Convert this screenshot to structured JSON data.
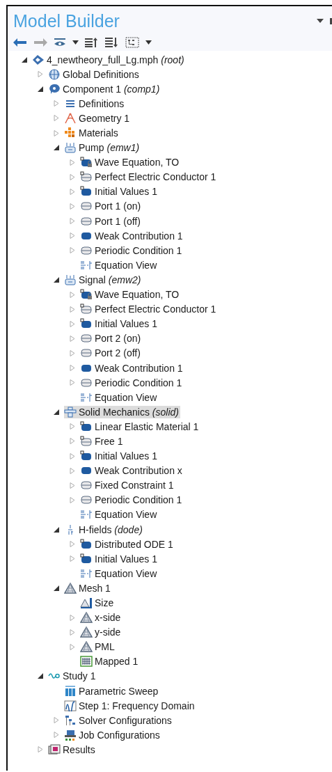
{
  "panel": {
    "title": "Model Builder"
  },
  "tree": [
    {
      "label": "4_newtheory_full_Lg.mph *(root)*",
      "kind": "file",
      "expanded": true,
      "selected": false,
      "children": [
        {
          "label": "Global Definitions",
          "kind": "globe",
          "expanded": false,
          "selected": false
        },
        {
          "label": "Component 1 *(comp1)*",
          "kind": "component",
          "expanded": true,
          "selected": false,
          "children": [
            {
              "label": "Definitions",
              "kind": "definitions",
              "expanded": false,
              "selected": false
            },
            {
              "label": "Geometry 1",
              "kind": "geometry",
              "expanded": false,
              "selected": false
            },
            {
              "label": "Materials",
              "kind": "materials",
              "expanded": false,
              "selected": false
            },
            {
              "label": "Pump *(emw1)*",
              "kind": "physics",
              "expanded": true,
              "selected": false,
              "children": [
                {
                  "label": "Wave Equation, TO",
                  "kind": "domain-locked",
                  "expanded": false,
                  "selected": false
                },
                {
                  "label": "Perfect Electric Conductor 1",
                  "kind": "boundary-default",
                  "expanded": false,
                  "selected": false
                },
                {
                  "label": "Initial Values 1",
                  "kind": "domain-default",
                  "expanded": false,
                  "selected": false
                },
                {
                  "label": "Port 1 (on)",
                  "kind": "boundary",
                  "expanded": false,
                  "selected": false
                },
                {
                  "label": "Port 1 (off)",
                  "kind": "boundary",
                  "expanded": false,
                  "selected": false
                },
                {
                  "label": "Weak Contribution 1",
                  "kind": "domain",
                  "expanded": false,
                  "selected": false
                },
                {
                  "label": "Periodic Condition 1",
                  "kind": "boundary",
                  "expanded": false,
                  "selected": false
                },
                {
                  "label": "Equation View",
                  "kind": "equation",
                  "selected": false
                }
              ]
            },
            {
              "label": "Signal *(emw2)*",
              "kind": "physics",
              "expanded": true,
              "selected": false,
              "children": [
                {
                  "label": "Wave Equation, TO",
                  "kind": "domain-locked",
                  "expanded": false,
                  "selected": false
                },
                {
                  "label": "Perfect Electric Conductor 1",
                  "kind": "boundary-default",
                  "expanded": false,
                  "selected": false
                },
                {
                  "label": "Initial Values 1",
                  "kind": "domain-default",
                  "expanded": false,
                  "selected": false
                },
                {
                  "label": "Port 2 (on)",
                  "kind": "boundary",
                  "expanded": false,
                  "selected": false
                },
                {
                  "label": "Port 2 (off)",
                  "kind": "boundary",
                  "expanded": false,
                  "selected": false
                },
                {
                  "label": "Weak Contribution 1",
                  "kind": "domain",
                  "expanded": false,
                  "selected": false
                },
                {
                  "label": "Periodic Condition 1",
                  "kind": "boundary",
                  "expanded": false,
                  "selected": false
                },
                {
                  "label": "Equation View",
                  "kind": "equation",
                  "selected": false
                }
              ]
            },
            {
              "label": "Solid Mechanics *(solid)*",
              "kind": "solid",
              "expanded": true,
              "selected": true,
              "children": [
                {
                  "label": "Linear Elastic Material 1",
                  "kind": "domain-default",
                  "expanded": false,
                  "selected": false
                },
                {
                  "label": "Free 1",
                  "kind": "boundary-default",
                  "expanded": false,
                  "selected": false
                },
                {
                  "label": "Initial Values 1",
                  "kind": "domain-default",
                  "expanded": false,
                  "selected": false
                },
                {
                  "label": "Weak Contribution x",
                  "kind": "domain",
                  "expanded": false,
                  "selected": false
                },
                {
                  "label": "Fixed Constraint 1",
                  "kind": "boundary",
                  "expanded": false,
                  "selected": false
                },
                {
                  "label": "Periodic Condition 1",
                  "kind": "boundary",
                  "expanded": false,
                  "selected": false
                },
                {
                  "label": "Equation View",
                  "kind": "equation",
                  "selected": false
                }
              ]
            },
            {
              "label": "H-fields *(dode)*",
              "kind": "ode",
              "expanded": true,
              "selected": false,
              "children": [
                {
                  "label": "Distributed ODE 1",
                  "kind": "domain-default",
                  "expanded": false,
                  "selected": false
                },
                {
                  "label": "Initial Values 1",
                  "kind": "domain-default",
                  "expanded": false,
                  "selected": false
                },
                {
                  "label": "Equation View",
                  "kind": "equation",
                  "selected": false
                }
              ]
            },
            {
              "label": "Mesh 1",
              "kind": "mesh",
              "expanded": true,
              "selected": false,
              "children": [
                {
                  "label": "Size",
                  "kind": "size",
                  "selected": false
                },
                {
                  "label": "x-side",
                  "kind": "mesh",
                  "expanded": false,
                  "selected": false
                },
                {
                  "label": "y-side",
                  "kind": "mesh",
                  "expanded": false,
                  "selected": false
                },
                {
                  "label": "PML",
                  "kind": "mesh",
                  "expanded": false,
                  "selected": false
                },
                {
                  "label": "Mapped 1",
                  "kind": "mapped",
                  "selected": false
                }
              ]
            }
          ]
        },
        {
          "label": "Study 1",
          "kind": "study",
          "expanded": true,
          "selected": false,
          "children": [
            {
              "label": "Parametric Sweep",
              "kind": "sweep",
              "selected": false
            },
            {
              "label": "Step 1: Frequency Domain",
              "kind": "step",
              "selected": false
            },
            {
              "label": "Solver Configurations",
              "kind": "solver",
              "expanded": false,
              "selected": false
            },
            {
              "label": "Job Configurations",
              "kind": "job",
              "expanded": false,
              "selected": false
            }
          ]
        },
        {
          "label": "Results",
          "kind": "results",
          "expanded": false,
          "selected": false
        }
      ]
    }
  ]
}
